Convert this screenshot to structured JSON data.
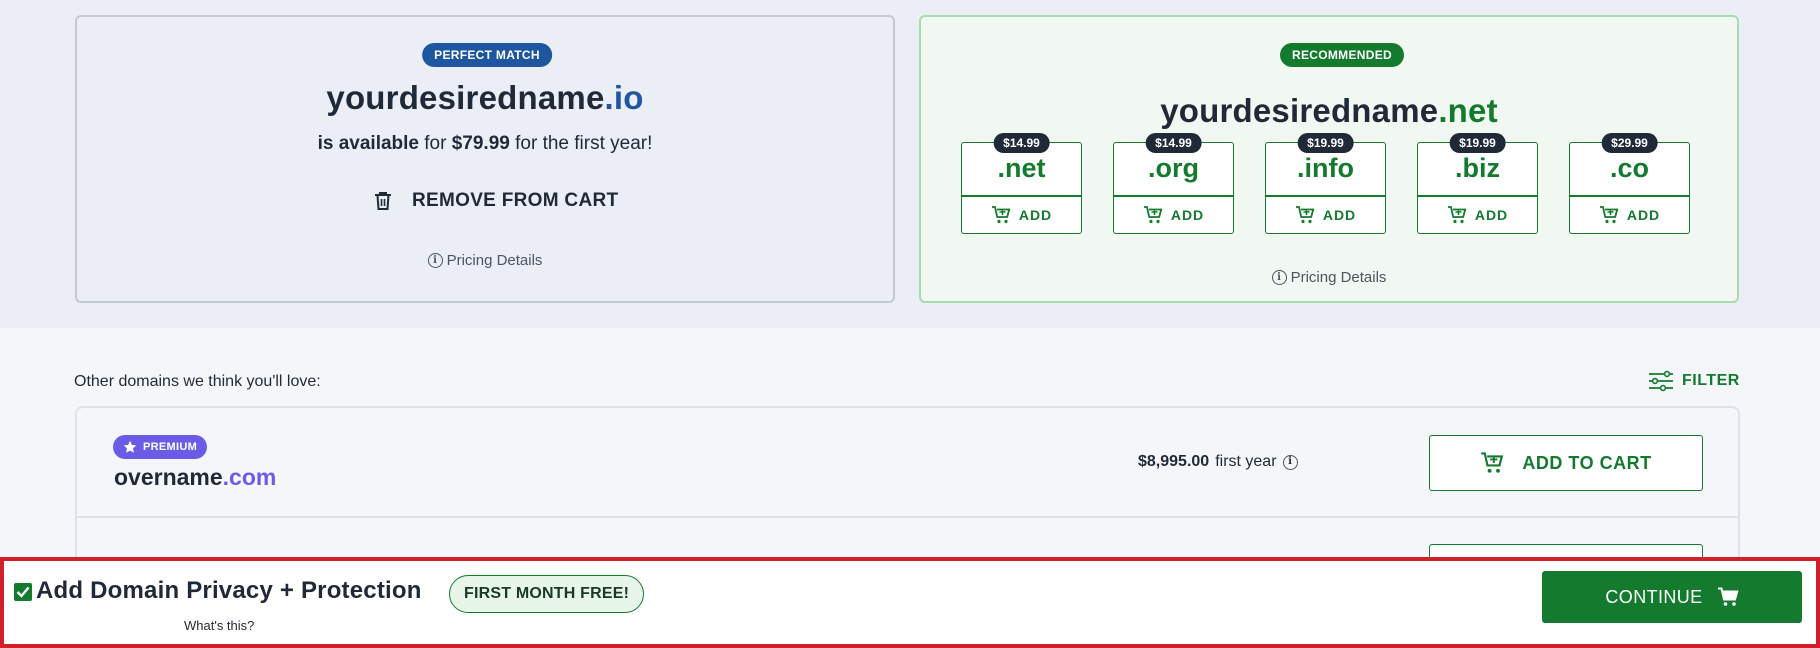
{
  "primary": {
    "badge": "PERFECT MATCH",
    "domain_name": "yourdesiredname",
    "domain_tld": ".io",
    "availability_prefix": "is available",
    "availability_for": " for ",
    "price": "$79.99",
    "availability_suffix": " for the first year!",
    "remove_label": "REMOVE FROM CART",
    "pricing_details": "Pricing Details"
  },
  "recommended": {
    "badge": "RECOMMENDED",
    "domain_name": "yourdesiredname",
    "domain_tld": ".net",
    "pricing_details": "Pricing Details",
    "tlds": [
      {
        "price": "$14.99",
        "tld": ".net",
        "add_label": "ADD"
      },
      {
        "price": "$14.99",
        "tld": ".org",
        "add_label": "ADD"
      },
      {
        "price": "$19.99",
        "tld": ".info",
        "add_label": "ADD"
      },
      {
        "price": "$19.99",
        "tld": ".biz",
        "add_label": "ADD"
      },
      {
        "price": "$29.99",
        "tld": ".co",
        "add_label": "ADD"
      }
    ]
  },
  "others": {
    "label": "Other domains we think you'll love:",
    "filter_label": "FILTER",
    "rows": [
      {
        "badge": "PREMIUM",
        "domain_name": "overname",
        "domain_tld": ".com",
        "price": "$8,995.00",
        "price_suffix": "first year",
        "add_label": "ADD TO CART"
      }
    ]
  },
  "bottom_bar": {
    "privacy_label": "Add Domain Privacy + Protection",
    "privacy_checked": true,
    "whats_this": "What's this?",
    "promo": "FIRST MONTH FREE!",
    "continue_label": "CONTINUE"
  },
  "colors": {
    "brand_green": "#137a2e",
    "brand_blue": "#1e56a0",
    "premium_purple": "#6b5ce7",
    "highlight_red": "#d1202a"
  },
  "icons": [
    "trash-icon",
    "info-icon",
    "cart-plus-icon",
    "filter-icon",
    "star-icon",
    "check-icon",
    "cart-icon"
  ]
}
